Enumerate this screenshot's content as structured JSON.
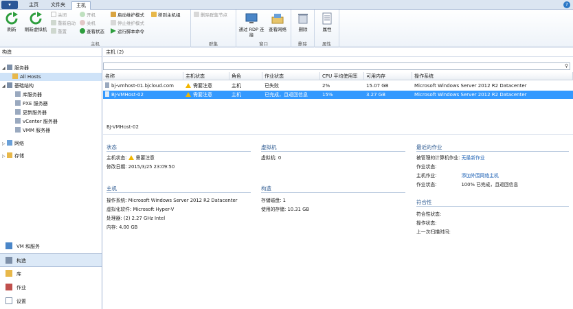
{
  "tabs": [
    "主页",
    "文件夹",
    "主机"
  ],
  "active_tab": "主机",
  "ribbon": {
    "groups": [
      {
        "label": "主机"
      },
      {
        "label": "群集"
      },
      {
        "label": "窗口"
      },
      {
        "label": "删除"
      },
      {
        "label": "属性"
      }
    ],
    "refresh": "刷新",
    "refresh_vm": "刷新虚拟机",
    "shutdown": "关闭",
    "reboot_start": "重新启动",
    "reset": "重置",
    "power_on": "开机",
    "power_off": "关机",
    "view_status": "查看状态",
    "start_maint": "启动维护模式",
    "stop_maint": "停止维护模式",
    "run_script": "运行脚本命令",
    "move_group": "移到主机组",
    "remove_node": "删除群集节点",
    "rdp": "通过 RDP 连接",
    "view_net": "查看网络",
    "delete": "删除",
    "props": "属性"
  },
  "leftnav": {
    "header": "构造",
    "tree": [
      {
        "label": "服务器",
        "level": 0,
        "twist": "◢"
      },
      {
        "label": "All Hosts",
        "level": 1,
        "selected": true
      },
      {
        "label": "基础结构",
        "level": 0,
        "twist": "◢"
      },
      {
        "label": "库服务器",
        "level": 1
      },
      {
        "label": "PXE 服务器",
        "level": 1
      },
      {
        "label": "更新服务器",
        "level": 1
      },
      {
        "label": "vCenter 服务器",
        "level": 1
      },
      {
        "label": "VMM 服务器",
        "level": 1
      },
      {
        "label": "网络",
        "level": 0,
        "twist": "▷"
      },
      {
        "label": "存储",
        "level": 0,
        "twist": "▷"
      }
    ],
    "workspaces": [
      {
        "label": "VM 和服务"
      },
      {
        "label": "构造",
        "selected": true
      },
      {
        "label": "库"
      },
      {
        "label": "作业"
      },
      {
        "label": "设置"
      }
    ]
  },
  "main": {
    "header": "主机 (2)",
    "columns": [
      "名称",
      "主机状态",
      "角色",
      "作业状态",
      "CPU 平均使用率",
      "可用内存",
      "操作系统"
    ],
    "rows": [
      {
        "name": "bj-vmhost-01.bjcloud.com",
        "status": "需要注意",
        "role": "主机",
        "job": "已失败",
        "cpu": "2%",
        "mem": "15.07 GB",
        "os": "Microsoft Windows Server 2012 R2 Datacenter",
        "selected": false
      },
      {
        "name": "BJ-VMHost-02",
        "status": "需要注意",
        "role": "主机",
        "job": "已完成，且返回信息",
        "cpu": "15%",
        "mem": "3.27 GB",
        "os": "Microsoft Windows Server 2012 R2 Datacenter",
        "selected": true
      }
    ],
    "detail_title": "BJ-VMHost-02"
  },
  "detail": {
    "status": {
      "title": "状态",
      "host_status_label": "主机状态:",
      "host_status_value": "需要注意",
      "modified_label": "修改日期:",
      "modified_value": "2015/3/25 23:09:50"
    },
    "host": {
      "title": "主机",
      "os_label": "操作系统:",
      "os_value": "Microsoft Windows Server 2012 R2 Datacenter",
      "virt_label": "虚拟化软件:",
      "virt_value": "Microsoft Hyper-V",
      "cpu_label": "处理器:",
      "cpu_value": "(2) 2.27 GHz  Intel",
      "mem_label": "内存:",
      "mem_value": "4.00 GB"
    },
    "vm": {
      "title": "虚拟机",
      "vm_label": "虚拟机:",
      "vm_value": "0"
    },
    "storage": {
      "title": "构造",
      "disk_label": "存储磁盘:",
      "disk_value": "1",
      "used_label": "使用的存储:",
      "used_value": "10.31 GB"
    },
    "recent_job": {
      "title": "最近的作业",
      "managed_label": "被管理的计算机作业:",
      "managed_value": "无最新作业",
      "job_status1_label": "作业状态:",
      "host_job_label": "主机作业:",
      "host_job_value": "添加外围网络主机",
      "job_status2_label": "作业状态:",
      "job_status2_value": "100% 已完成，且返回信息"
    },
    "compliance": {
      "title": "符合性",
      "comp_label": "符合性状态:",
      "op_label": "操作状态:",
      "scan_label": "上一次扫描时间:"
    }
  },
  "colors": {
    "accent": "#2b5797",
    "selection": "#3399ff",
    "warning": "#f2b600",
    "link": "#1a5fb4"
  }
}
